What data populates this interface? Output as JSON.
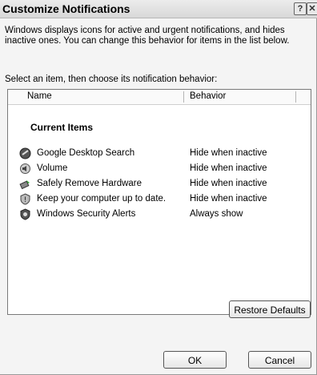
{
  "window": {
    "title": "Customize Notifications",
    "help_glyph": "?",
    "close_glyph": "✕"
  },
  "description": "Windows displays icons for active and urgent notifications, and hides inactive ones. You can change this behavior for items in the list below.",
  "prompt": "Select an item, then choose its notification behavior:",
  "list": {
    "columns": [
      "Name",
      "Behavior"
    ],
    "group_label": "Current Items",
    "items": [
      {
        "icon": "google-desktop-icon",
        "name": "Google Desktop Search",
        "behavior": "Hide when inactive"
      },
      {
        "icon": "volume-icon",
        "name": "Volume",
        "behavior": "Hide when inactive"
      },
      {
        "icon": "safely-remove-hardware-icon",
        "name": "Safely Remove Hardware",
        "behavior": "Hide when inactive"
      },
      {
        "icon": "windows-update-icon",
        "name": "Keep your computer up to date.",
        "behavior": "Hide when inactive"
      },
      {
        "icon": "security-alert-icon",
        "name": "Windows Security Alerts",
        "behavior": "Always show"
      }
    ]
  },
  "buttons": {
    "restore_defaults": "Restore Defaults",
    "ok": "OK",
    "cancel": "Cancel"
  }
}
